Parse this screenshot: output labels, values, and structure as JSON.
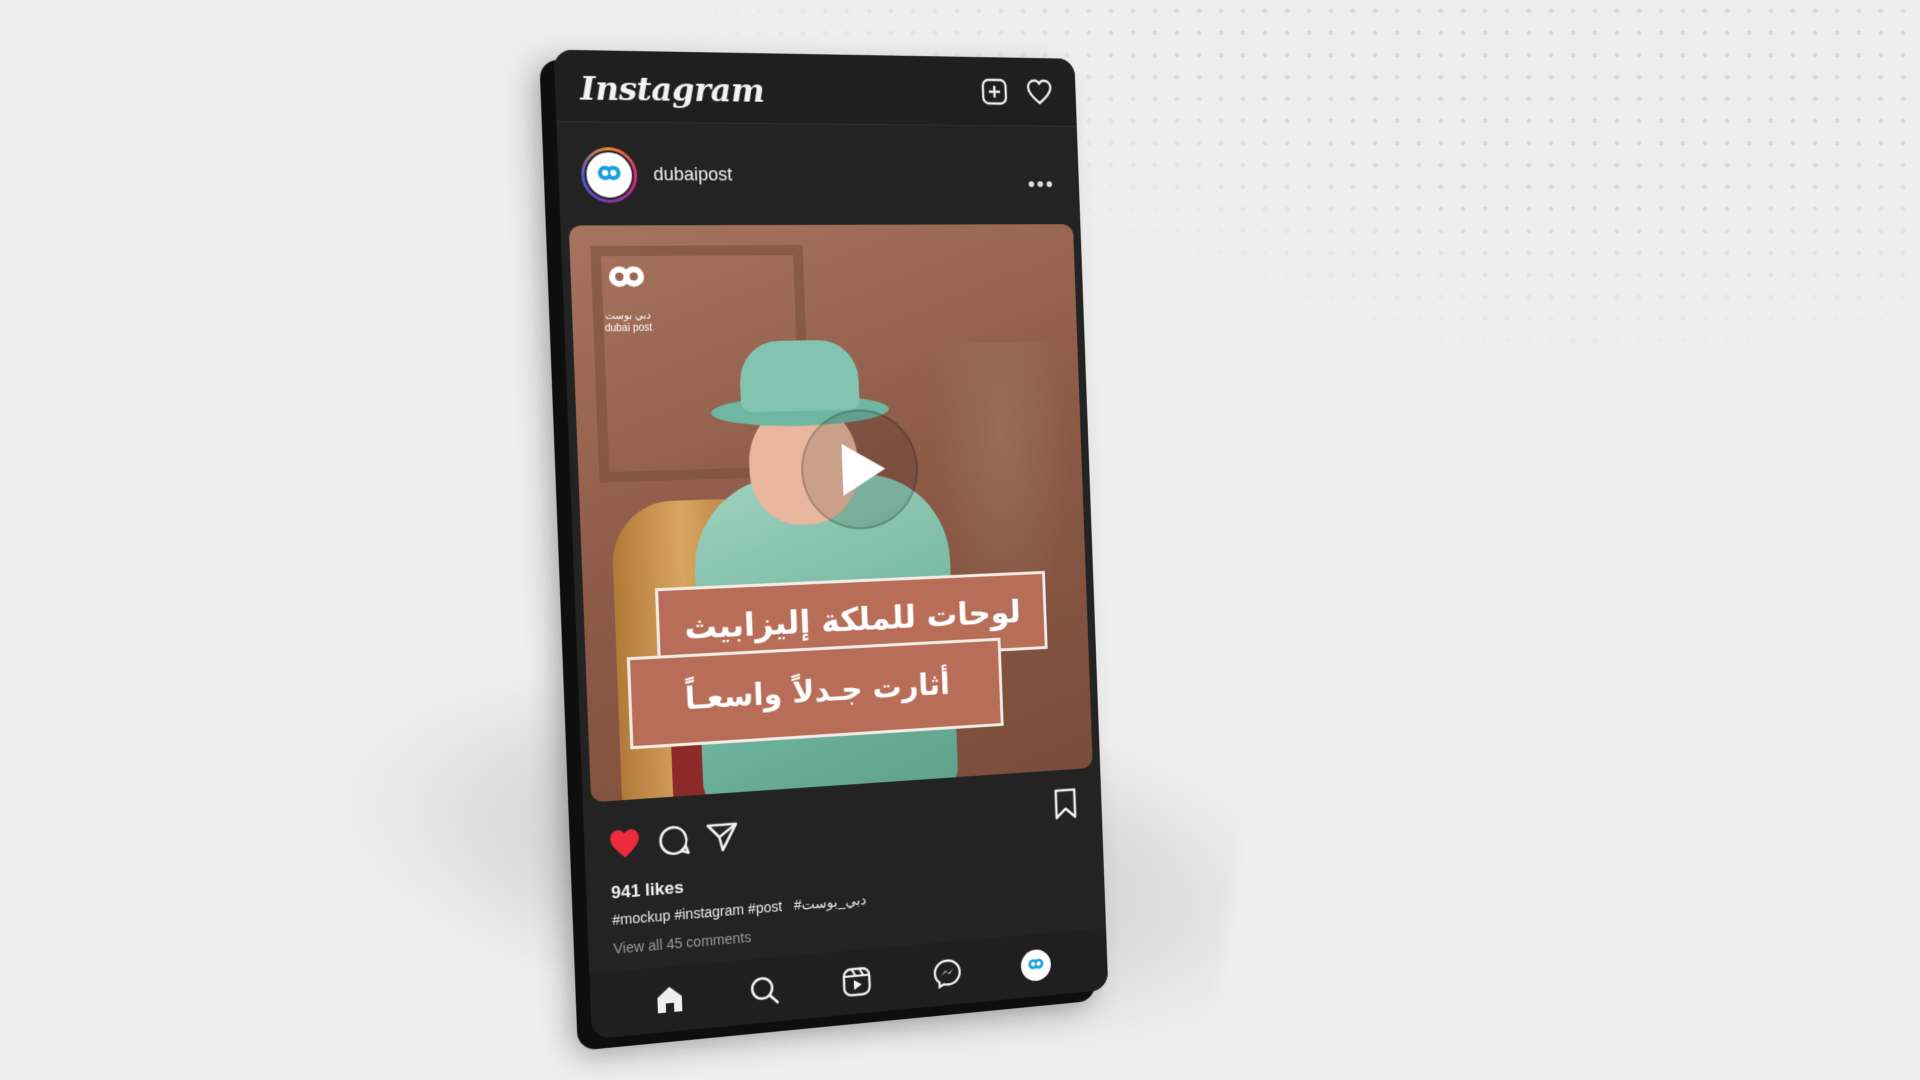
{
  "app": {
    "name": "Instagram"
  },
  "header": {
    "logo_text": "Instagram",
    "icons": [
      "new-post-icon",
      "heart-icon"
    ]
  },
  "post": {
    "username": "dubaipost",
    "media": {
      "logo_ar": "دبي بوست",
      "logo_en": "dubai post",
      "headline_line1": "لوحات للملكة إليزابيث",
      "headline_line2": "أثارت جـدلاً واسعـاً",
      "type": "video"
    },
    "likes_text": "941 likes",
    "caption_tags": "#mockup #instagram #post",
    "caption_ar_tag": "#دبي_بوست",
    "comments_link": "View all 45 comments",
    "liked": true
  },
  "tabbar": {
    "items": [
      "home-icon",
      "search-icon",
      "reels-icon",
      "messenger-icon",
      "profile-avatar"
    ]
  },
  "colors": {
    "background": "#eeeeef",
    "phone": "#232323",
    "like_red": "#ed2b3c",
    "banner": "#b86d59"
  }
}
